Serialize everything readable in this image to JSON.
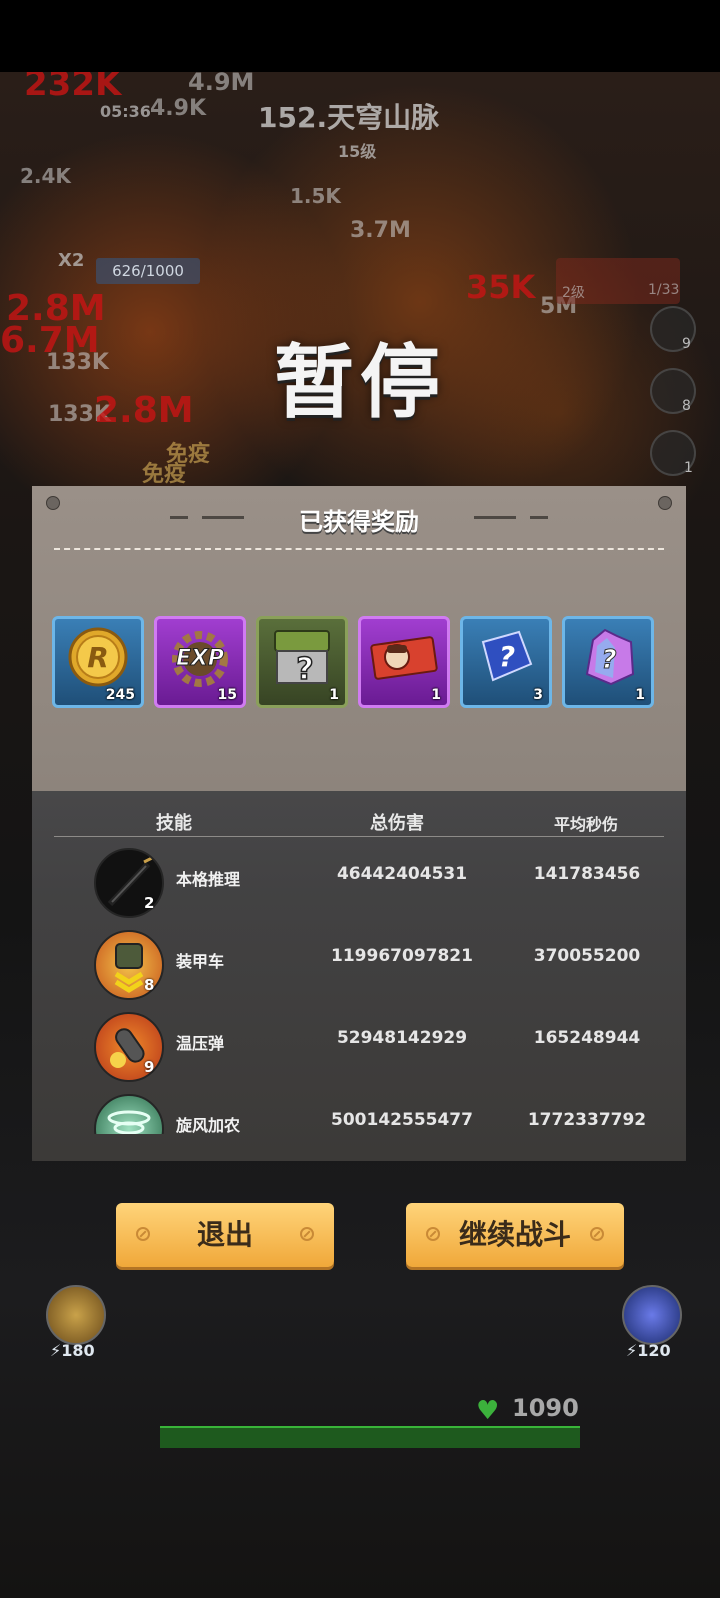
{
  "hud": {
    "stage": "152.天穹山脉",
    "timer": "05:36",
    "level": "15级",
    "exp": "626/1000",
    "weapon_level": "2级",
    "weapon_ammo": "1/33",
    "multiplier": "X2",
    "side_counts": [
      "9",
      "8",
      "1"
    ],
    "left_ability_cost": "180",
    "right_ability_cost": "120",
    "hp": "1090",
    "floating_numbers": [
      "232K",
      "4.9M",
      "4.9K",
      "2.4K",
      "1.5K",
      "3.7M",
      "35K",
      "5M",
      "2.8M",
      "6.7M",
      "133K",
      "133K",
      "2.8M",
      "免疫",
      "免疫"
    ]
  },
  "pause": {
    "title": "暂停",
    "rewards_title": "已获得奖励",
    "rewards": [
      {
        "icon": "gold-coin-icon",
        "label": "R",
        "qty": "245",
        "color": "blue"
      },
      {
        "icon": "exp-gear-icon",
        "label": "EXP",
        "qty": "15",
        "color": "purple"
      },
      {
        "icon": "mystery-chest-icon",
        "label": "?",
        "qty": "1",
        "color": "green"
      },
      {
        "icon": "ticket-icon",
        "label": "",
        "qty": "1",
        "color": "purple"
      },
      {
        "icon": "mystery-cube-icon",
        "label": "?",
        "qty": "3",
        "color": "blue"
      },
      {
        "icon": "mystery-crystal-icon",
        "label": "?",
        "qty": "1",
        "color": "blue"
      }
    ],
    "table": {
      "headers": [
        "技能",
        "总伤害",
        "平均秒伤"
      ],
      "rows": [
        {
          "name": "本格推理",
          "level": "2",
          "total": "46442404531",
          "dps": "141783456",
          "icon": "umbrella-skill-icon"
        },
        {
          "name": "装甲车",
          "level": "8",
          "total": "119967097821",
          "dps": "370055200",
          "icon": "armored-car-skill-icon"
        },
        {
          "name": "温压弹",
          "level": "9",
          "total": "52948142929",
          "dps": "165248944",
          "icon": "thermobaric-shell-skill-icon"
        },
        {
          "name": "旋风加农",
          "level": "",
          "total": "500142555477",
          "dps": "1772337792",
          "icon": "whirlwind-cannon-skill-icon"
        }
      ]
    },
    "buttons": {
      "exit": "退出",
      "continue": "继续战斗"
    }
  },
  "colors": {
    "button": "#f0a83a",
    "reward_blue": "#3a7fb6",
    "reward_purple": "#a13ed0",
    "reward_green": "#5a6f3b",
    "damage_red": "#c81414"
  }
}
